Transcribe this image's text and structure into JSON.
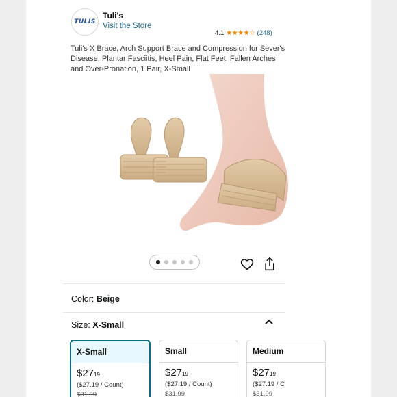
{
  "brand": {
    "logo_text": "TULIS",
    "name": "Tuli's",
    "visit_store": "Visit the Store"
  },
  "rating": {
    "value": "4.1",
    "stars": "★★★★☆",
    "count": "(248)"
  },
  "product": {
    "title": "Tuli's X Brace, Arch Support Brace and Compression for Sever's Disease, Plantar Fasciitis, Heel Pain, Flat Feet, Fallen Arches and Over-Pronation, 1 Pair, X-Small"
  },
  "gallery": {
    "dots_total": 5,
    "active_index": 0
  },
  "color": {
    "label": "Color:",
    "value": "Beige"
  },
  "size": {
    "label": "Size:",
    "value": "X-Small"
  },
  "sizes": [
    {
      "name": "X-Small",
      "dollars": "$27",
      "cents": "19",
      "per_unit": "($27.19 / Count)",
      "list_price": "$31.99",
      "selected": true
    },
    {
      "name": "Small",
      "dollars": "$27",
      "cents": "19",
      "per_unit": "($27.19 / Count)",
      "list_price": "$31.99",
      "selected": false
    },
    {
      "name": "Medium",
      "dollars": "$27",
      "cents": "19",
      "per_unit": "($27.19 / C",
      "list_price": "$31.99",
      "selected": false
    }
  ],
  "colors": {
    "link": "#1f6c8f",
    "star": "#f08804",
    "selected_border": "#007185",
    "beige": "#d9bf9c"
  }
}
